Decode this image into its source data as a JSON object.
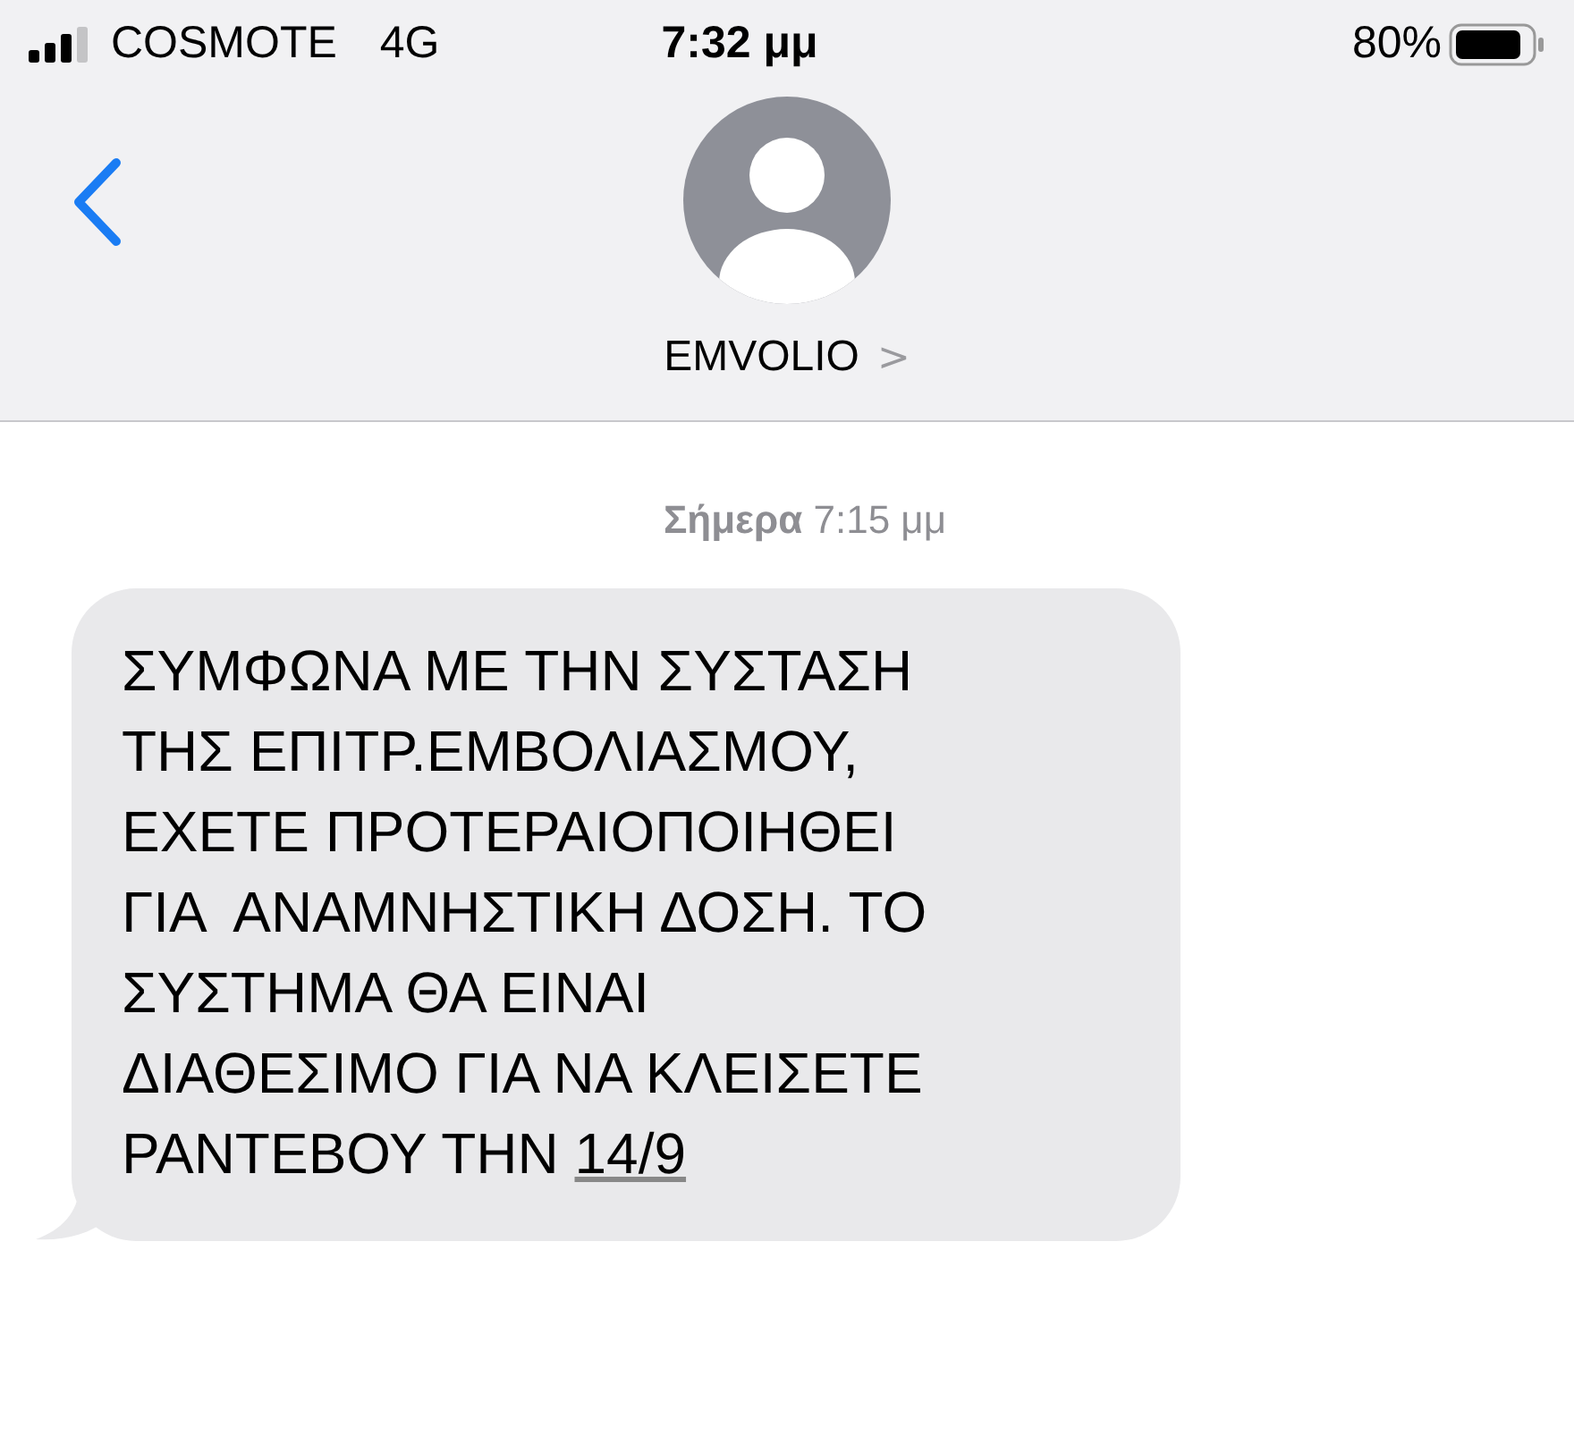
{
  "status_bar": {
    "carrier": "COSMOTE",
    "network": "4G",
    "time": "7:32 μμ",
    "battery": "80%"
  },
  "header": {
    "contact": "EMVOLIO",
    "chevron": ">"
  },
  "timestamp": "**Σήμερα** 7:15 μμ",
  "message": {
    "lines": [
      "ΣΥΜΦΩΝΑ ΜΕ ΤΗΝ ΣΥΣΤΑΣΗ",
      "ΤΗΣ ΕΠΙΤΡ.ΕΜΒΟΛΙΑΣΜΟΥ,",
      "ΕΧΕΤΕ ΠΡΟΤΕΡΑΙΟΠΟΙΗΘΕΙ",
      "ΓΙΑ  ΑΝΑΜΝΗΣΤΙΚΗ ΔΟΣΗ. ΤΟ",
      "ΣΥΣΤΗΜΑ ΘΑ ΕΙΝΑΙ",
      "ΔΙΑΘΕΣΙΜΟ ΓΙΑ ΝΑ ΚΛΕΙΣΕΤΕ",
      "ΡΑΝΤΕΒΟΥ ΤΗΝ "
    ],
    "link": "14/9"
  }
}
